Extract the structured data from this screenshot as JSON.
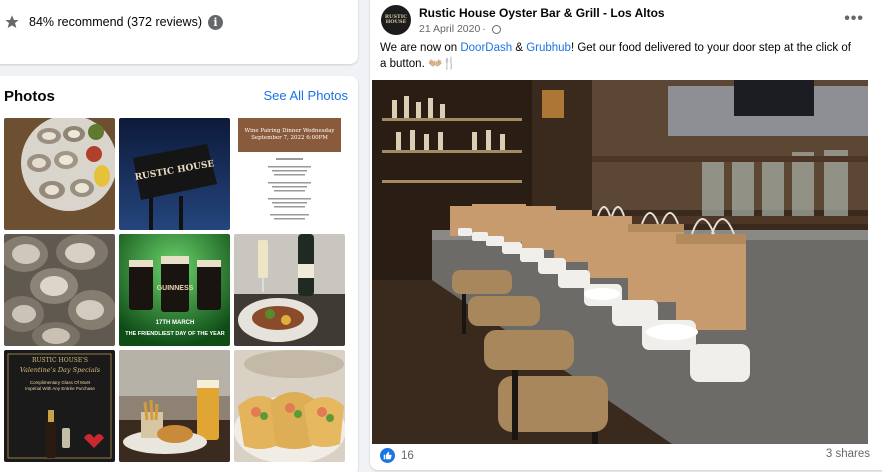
{
  "recommendation": {
    "text": "84% recommend (372 reviews)",
    "info_icon": "i"
  },
  "photos": {
    "title": "Photos",
    "see_all": "See All Photos",
    "thumbs": [
      {
        "name": "oysters-platter-photo"
      },
      {
        "name": "rustic-house-sign-photo",
        "sign_text": "RUSTIC HOUSE"
      },
      {
        "name": "wine-pairing-menu-photo",
        "header": "Wine Pairing Dinner Wednesday September 7, 2022 6:00PM"
      },
      {
        "name": "oysters-closeup-photo"
      },
      {
        "name": "guinness-pints-photo",
        "brand": "GUINNESS",
        "date": "17TH MARCH",
        "tagline": "THE FRIENDLIEST DAY OF THE YEAR"
      },
      {
        "name": "moet-champagne-dinner-photo"
      },
      {
        "name": "valentines-specials-photo",
        "brand": "RUSTIC HOUSE'S",
        "title": "Valentine's Day Specials",
        "subtitle": "Complimentary Glass Of Moët Impérial With Any Entrée Purchase"
      },
      {
        "name": "fish-and-chips-beer-photo"
      },
      {
        "name": "tacos-photo"
      }
    ]
  },
  "post": {
    "page_name": "Rustic House Oyster Bar & Grill - Los Altos",
    "date": "21 April 2020",
    "avatar_text": "RUSTIC HOUSE",
    "text_before": "We are now on ",
    "link1": "DoorDash",
    "text_mid": " & ",
    "link2": "Grubhub",
    "text_after": "! Get our food delivered to your door step at the click of a button. 👐🏼🍴",
    "more": "•••",
    "like_count": "16",
    "shares": "3 shares"
  },
  "colors": {
    "link": "#1b74e4",
    "secondary_text": "#65676b",
    "background": "#f0f2f5"
  }
}
